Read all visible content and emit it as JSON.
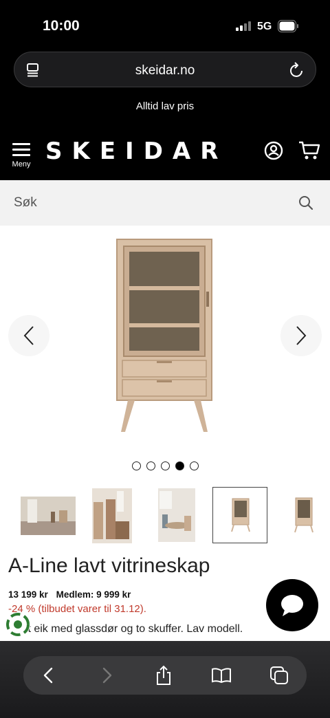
{
  "status_bar": {
    "time": "10:00",
    "network": "5G"
  },
  "browser": {
    "url": "skeidar.no"
  },
  "promo": {
    "text": "Alltid lav pris"
  },
  "header": {
    "menu_label": "Meny",
    "logo_text": "SKEIDAR"
  },
  "search": {
    "placeholder": "Søk"
  },
  "gallery": {
    "image_count": 5,
    "active_index": 3,
    "thumbnail_count": 5,
    "selected_thumbnail": 3
  },
  "product": {
    "title": "A-Line lavt vitrineskap",
    "price": "13 199 kr",
    "member_price": "Medlem: 9 999 kr",
    "offer": "-24 % (tilbudet varer til 31.12).",
    "offer_visible": "-% (tilbudet varer til 31.12).",
    "description": "Oljet eik med glassdør og to skuffer. Lav modell."
  },
  "colors": {
    "header_bg": "#000000",
    "search_bg": "#f2f2f2",
    "offer_red": "#c0392b",
    "chat_bg": "#000000"
  },
  "icons": [
    "menu-icon",
    "reload-icon",
    "account-icon",
    "cart-icon",
    "search-icon",
    "chevron-left-icon",
    "chevron-right-icon",
    "chat-icon",
    "eco-icon",
    "back-icon",
    "forward-icon",
    "share-icon",
    "bookmarks-icon",
    "tabs-icon"
  ]
}
